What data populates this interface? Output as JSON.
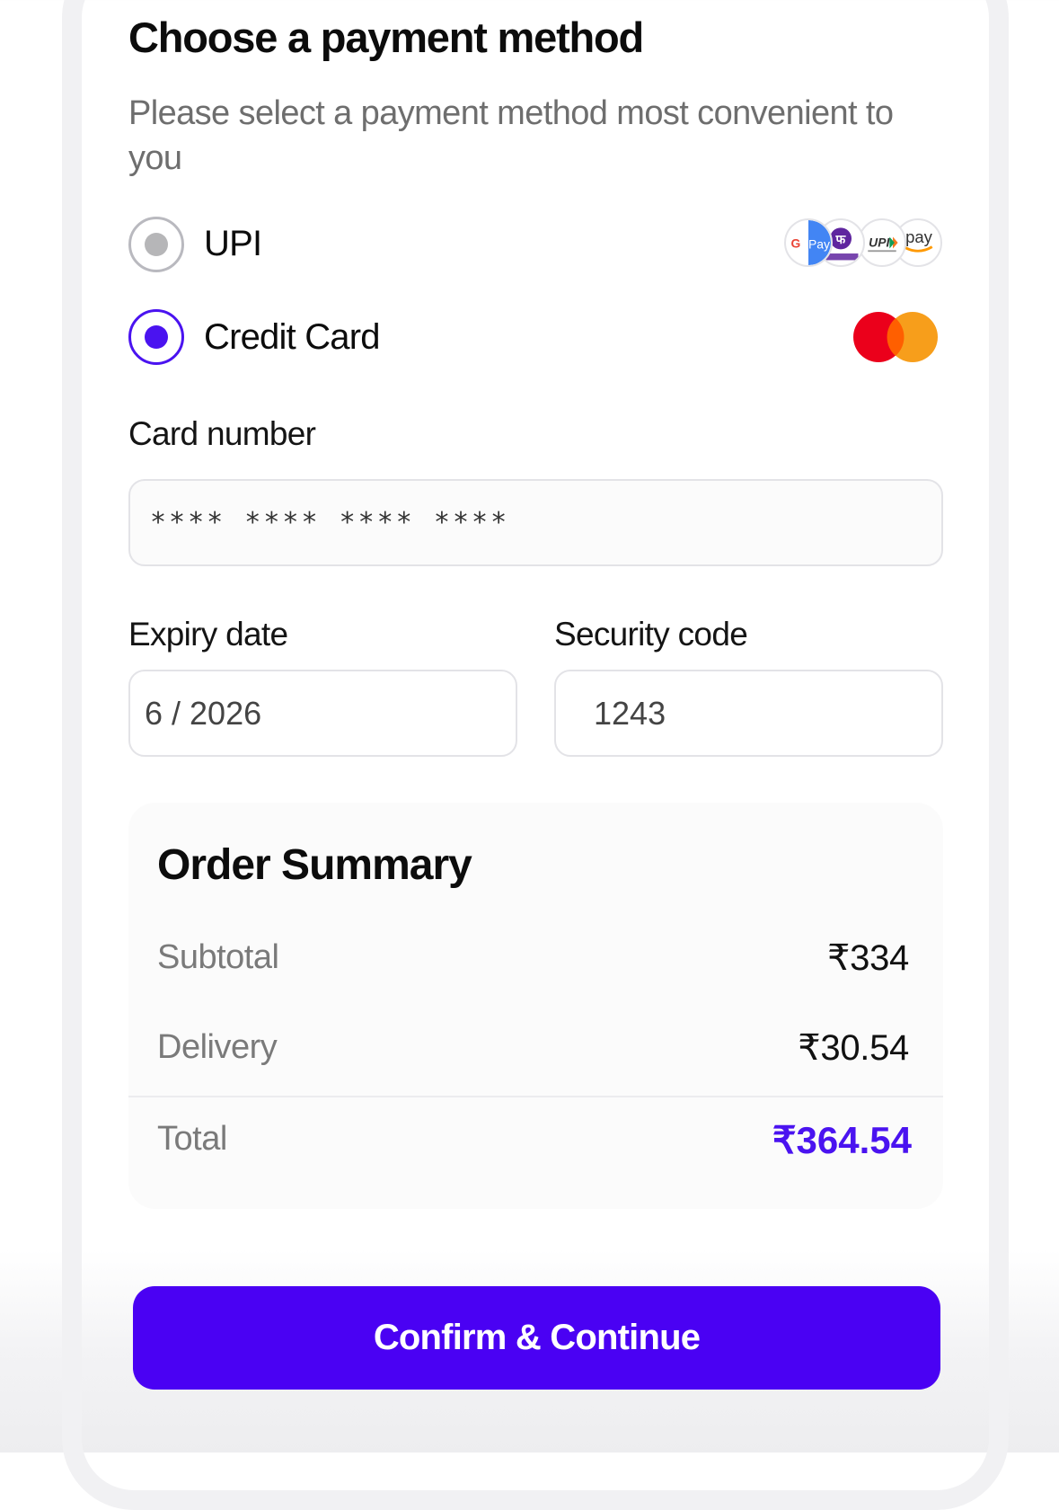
{
  "header": {
    "title": "Choose a payment method",
    "subtitle": "Please select  a payment method most convenient to you"
  },
  "payment_options": {
    "upi": {
      "label": "UPI",
      "selected": false,
      "logos": [
        "google-pay-icon",
        "phonepe-icon",
        "upi-icon",
        "amazon-pay-icon"
      ],
      "logo_texts": {
        "gpay": "Pay",
        "upi": "UPI",
        "amazon": "pay"
      }
    },
    "credit_card": {
      "label": "Credit Card",
      "selected": true,
      "logos": [
        "mastercard-icon"
      ]
    }
  },
  "card_form": {
    "card_number_label": "Card number",
    "card_number_value": "**** **** **** ****",
    "expiry_label": "Expiry date",
    "expiry_value": "6 / 2026",
    "security_label": "Security code",
    "security_value": "1243"
  },
  "order_summary": {
    "title": "Order Summary",
    "rows": [
      {
        "label": "Subtotal",
        "value": "₹334"
      },
      {
        "label": "Delivery",
        "value": "₹30.54"
      }
    ],
    "total": {
      "label": "Total",
      "value": "₹364.54"
    }
  },
  "actions": {
    "confirm_label": "Confirm & Continue"
  },
  "colors": {
    "accent": "#4a13f0",
    "button": "#4a01f3",
    "mastercard_red": "#eb001b",
    "mastercard_orange": "#f79e1b"
  }
}
